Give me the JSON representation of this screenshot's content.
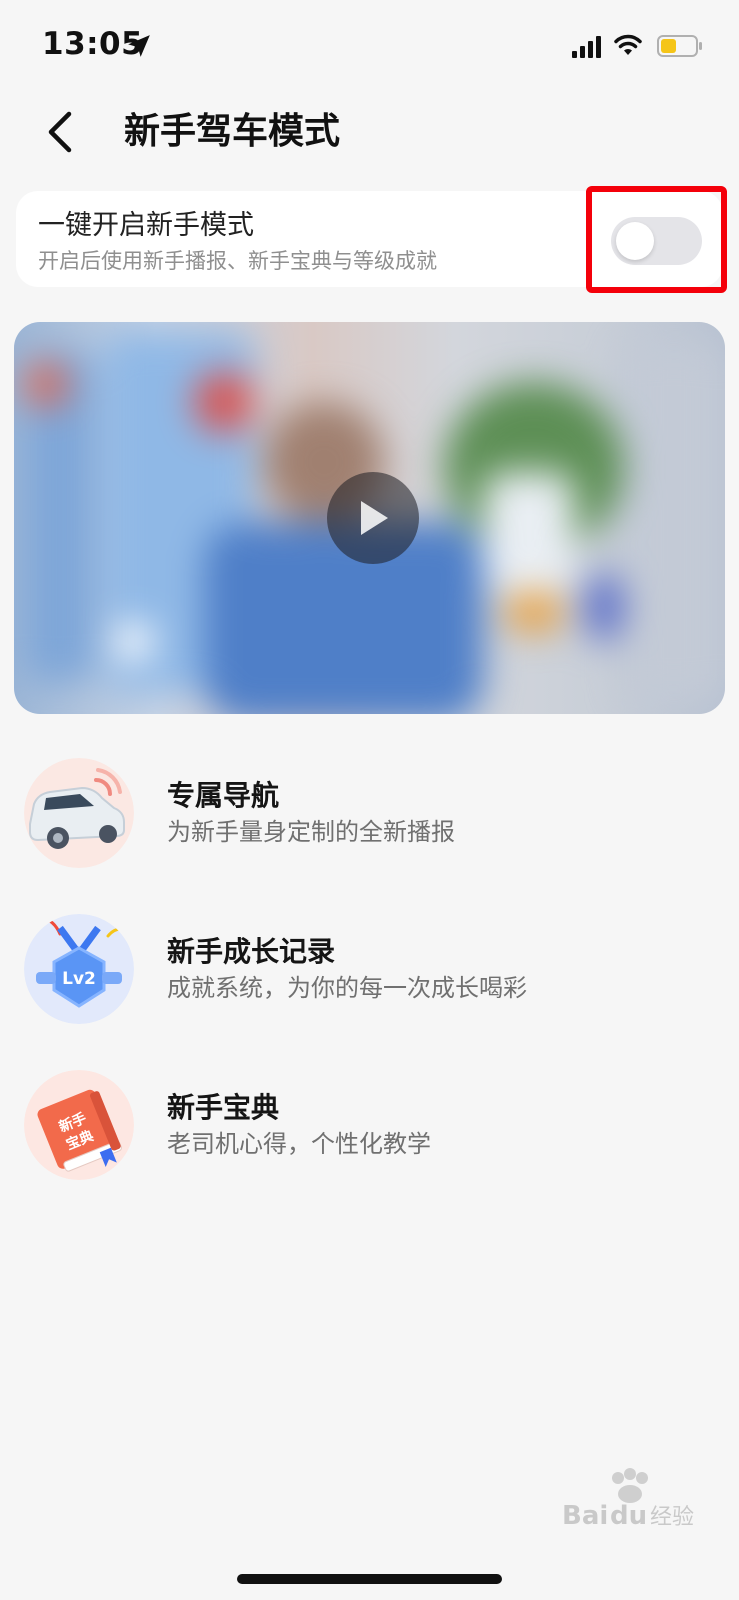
{
  "status_bar": {
    "time": "13:05",
    "icons": [
      "location-arrow-icon",
      "cellular-signal-icon",
      "wifi-icon",
      "battery-icon"
    ]
  },
  "header": {
    "back_icon": "chevron-left-icon",
    "title": "新手驾车模式"
  },
  "toggle_card": {
    "title": "一键开启新手模式",
    "subtitle": "开启后使用新手播报、新手宝典与等级成就",
    "enabled": false
  },
  "video": {
    "play_icon": "play-icon"
  },
  "features": [
    {
      "icon": "car-navigation-icon",
      "title": "专属导航",
      "description": "为新手量身定制的全新播报"
    },
    {
      "icon": "lv2-medal-icon",
      "title": "新手成长记录",
      "description": "成就系统，为你的每一次成长喝彩"
    },
    {
      "icon": "beginner-book-icon",
      "title": "新手宝典",
      "description": "老司机心得，个性化教学",
      "icon_text": "新手宝典"
    }
  ],
  "medal_badge": "Lv2",
  "watermark": "Baidu经验",
  "colors": {
    "background": "#f6f6f6",
    "card": "#ffffff",
    "highlight": "#f4000a",
    "toggle_off": "#e4e4e8",
    "battery": "#f5c518"
  }
}
